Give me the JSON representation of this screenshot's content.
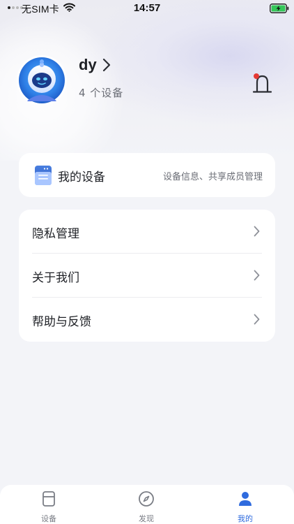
{
  "status_bar": {
    "carrier": "无SIM卡",
    "time": "14:57",
    "icons": [
      "signal-dots-icon",
      "wifi-icon",
      "battery-charging-icon"
    ]
  },
  "profile": {
    "username": "dy",
    "device_count": "4 个设备",
    "avatar_icon": "astronaut-avatar-icon",
    "notification_icon": "bell-icon",
    "has_unread": true
  },
  "device_card": {
    "icon": "device-icon",
    "title": "我的设备",
    "description": "设备信息、共享成员管理"
  },
  "menu": {
    "items": [
      {
        "label": "隐私管理",
        "icon": "chevron-right-icon"
      },
      {
        "label": "关于我们",
        "icon": "chevron-right-icon"
      },
      {
        "label": "帮助与反馈",
        "icon": "chevron-right-icon"
      }
    ]
  },
  "tab_bar": {
    "tabs": [
      {
        "label": "设备",
        "icon": "device-tab-icon",
        "active": false
      },
      {
        "label": "发现",
        "icon": "compass-icon",
        "active": false
      },
      {
        "label": "我的",
        "icon": "person-icon",
        "active": true
      }
    ]
  },
  "colors": {
    "accent": "#2f6bde",
    "badge": "#e53935",
    "background": "#f3f4f8",
    "card": "#ffffff"
  }
}
